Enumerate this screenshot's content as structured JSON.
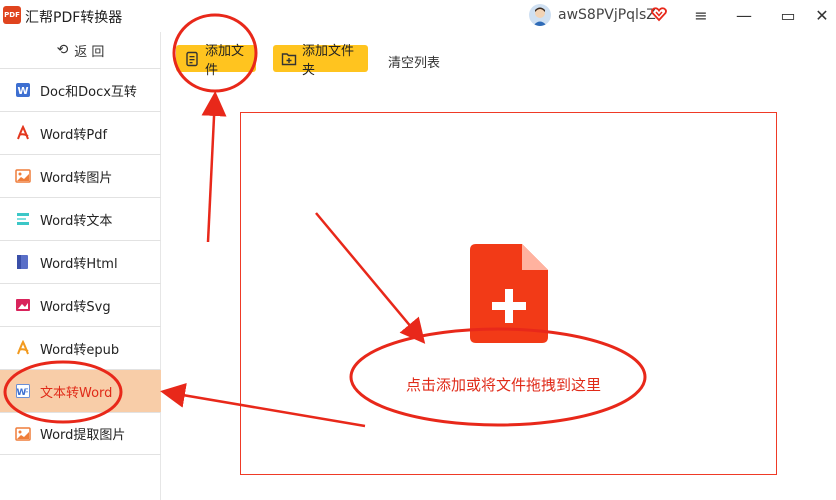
{
  "app": {
    "logo_text": "PDF",
    "title": "汇帮PDF转换器"
  },
  "user": {
    "name": "awS8PVjPqlsZ"
  },
  "window_controls": {
    "menu": "≡",
    "minimize": "—",
    "maximize": "▭",
    "close": "✕"
  },
  "sidebar": {
    "back_label": "返   回",
    "items": [
      {
        "label": "Doc和Docx互转",
        "icon": "word-doc-icon",
        "active": false
      },
      {
        "label": "Word转Pdf",
        "icon": "pdf-icon",
        "active": false
      },
      {
        "label": "Word转图片",
        "icon": "image-icon",
        "active": false
      },
      {
        "label": "Word转文本",
        "icon": "text-icon",
        "active": false
      },
      {
        "label": "Word转Html",
        "icon": "html-icon",
        "active": false
      },
      {
        "label": "Word转Svg",
        "icon": "svg-icon",
        "active": false
      },
      {
        "label": "Word转epub",
        "icon": "epub-icon",
        "active": false
      },
      {
        "label": "文本转Word",
        "icon": "word-icon",
        "active": true
      },
      {
        "label": "Word提取图片",
        "icon": "extract-image-icon",
        "active": false
      }
    ]
  },
  "toolbar": {
    "add_file": "添加文件",
    "add_folder": "添加文件夹",
    "clear_list": "清空列表"
  },
  "drop_zone": {
    "hint": "点击添加或将文件拖拽到这里"
  },
  "colors": {
    "accent": "#ffc41f",
    "active_bg": "#f8cda8",
    "highlight_red": "#e02a18",
    "annotation_red": "#e8281a"
  }
}
